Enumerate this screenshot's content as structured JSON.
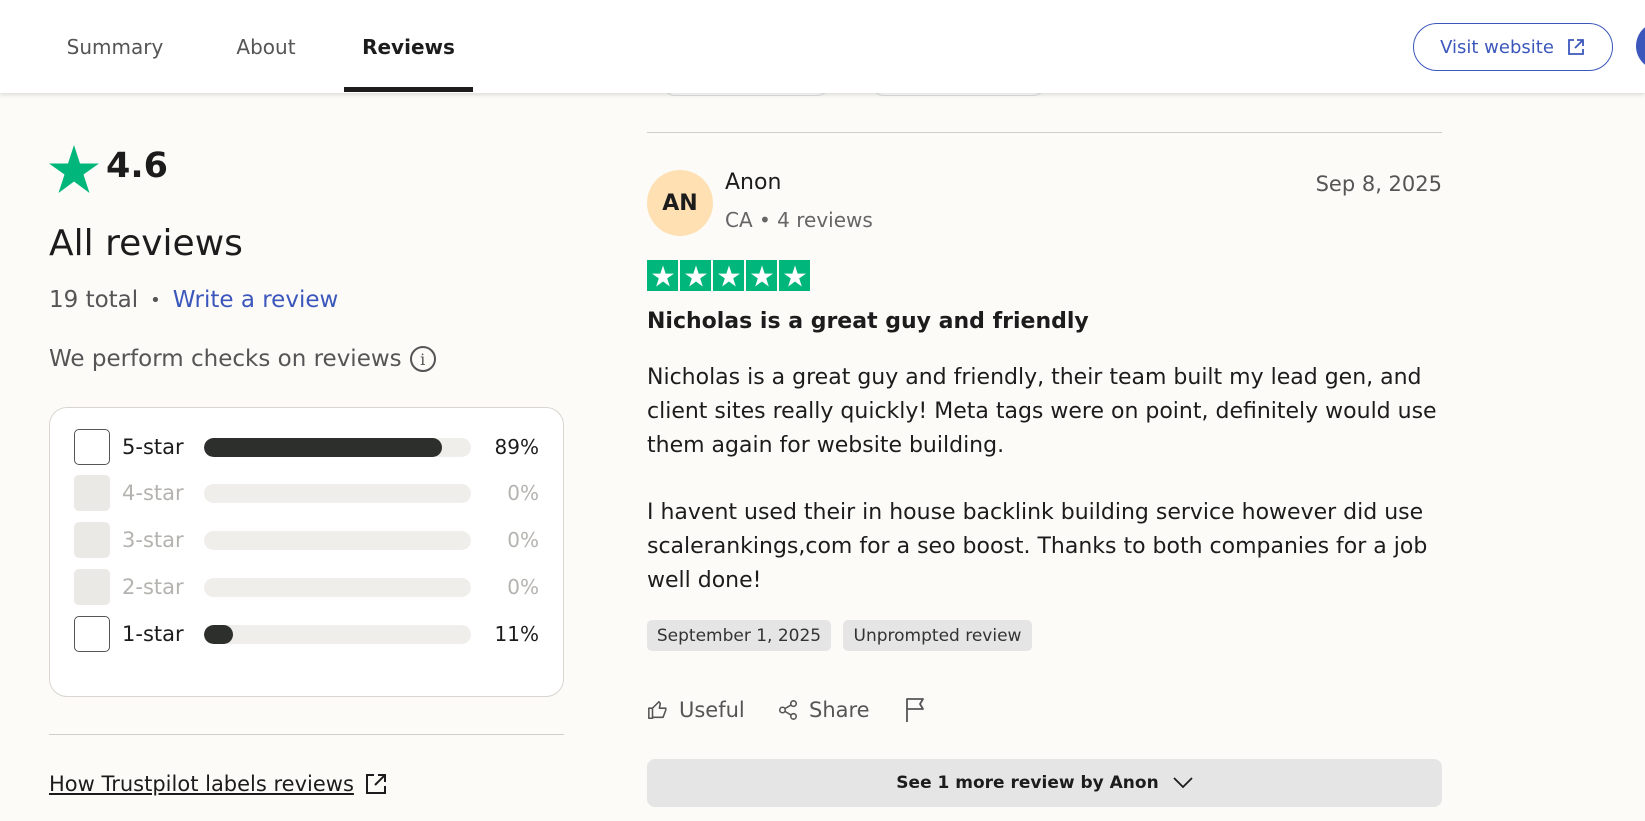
{
  "header": {
    "tabs": [
      {
        "label": "Summary",
        "active": false
      },
      {
        "label": "About",
        "active": false
      },
      {
        "label": "Reviews",
        "active": true
      }
    ],
    "visit_website_label": "Visit website"
  },
  "summary": {
    "rating": "4.6",
    "heading": "All reviews",
    "total": "19 total",
    "separator": "•",
    "write_review_label": "Write a review",
    "checks_label": "We perform checks on reviews",
    "distribution": [
      {
        "label": "5-star",
        "percent_text": "89%",
        "percent": 89,
        "enabled": true
      },
      {
        "label": "4-star",
        "percent_text": "0%",
        "percent": 0,
        "enabled": false
      },
      {
        "label": "3-star",
        "percent_text": "0%",
        "percent": 0,
        "enabled": false
      },
      {
        "label": "2-star",
        "percent_text": "0%",
        "percent": 0,
        "enabled": false
      },
      {
        "label": "1-star",
        "percent_text": "11%",
        "percent": 11,
        "enabled": true
      }
    ],
    "labels_link": "How Trustpilot labels reviews"
  },
  "review": {
    "avatar_initials": "AN",
    "reviewer_name": "Anon",
    "reviewer_meta": "CA • 4 reviews",
    "date": "Sep 8, 2025",
    "stars": 5,
    "title": "Nicholas is a great guy and friendly",
    "body_paragraphs": [
      "Nicholas is a great guy and friendly, their team built my lead gen, and client sites really quickly! Meta tags were on point, definitely would use them again for website building.",
      "I havent used their in house backlink building service however did use scalerankings,com for a seo boost. Thanks to both companies for a job well done!"
    ],
    "experience_date": "September 1, 2025",
    "prompt_tag": "Unprompted review",
    "useful_label": "Useful",
    "share_label": "Share",
    "see_more_label": "See 1 more review by Anon"
  },
  "colors": {
    "trustpilot_green": "#00b67a",
    "link_blue": "#3c57bc",
    "avatar_bg": "#ffe0b3",
    "bar_fill": "#2d2f2c"
  }
}
